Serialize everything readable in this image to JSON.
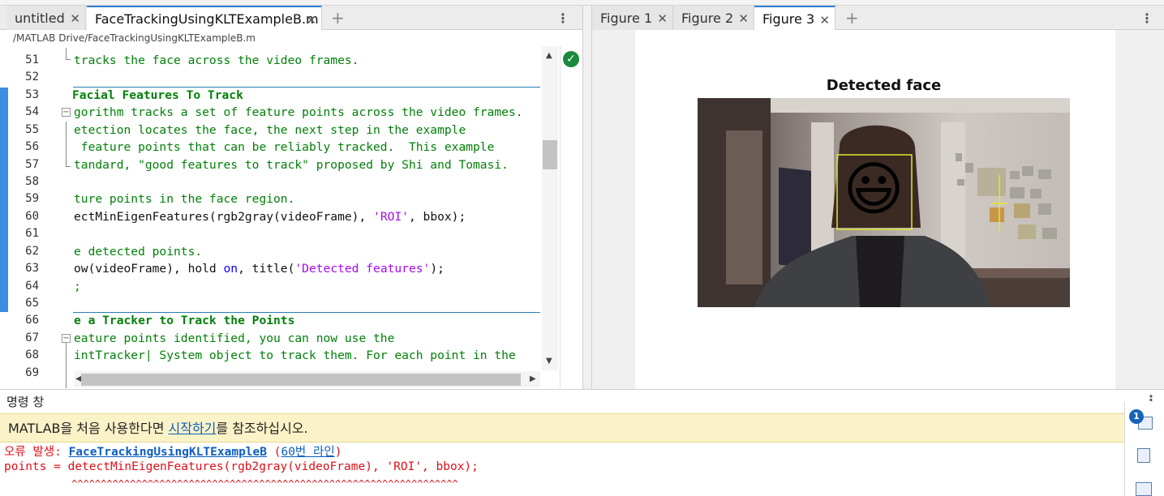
{
  "editor": {
    "tabs": [
      {
        "label": "untitled",
        "active": false
      },
      {
        "label": "FaceTrackingUsingKLTExampleB.m",
        "active": true
      }
    ],
    "path": "/MATLAB Drive/FaceTrackingUsingKLTExampleB.m",
    "lines": [
      {
        "num": "51",
        "text": "tracks the face across the video frames."
      },
      {
        "num": "52",
        "text": ""
      },
      {
        "num": "53",
        "text": "Facial Features To Track"
      },
      {
        "num": "54",
        "text": "gorithm tracks a set of feature points across the video frames."
      },
      {
        "num": "55",
        "text": "etection locates the face, the next step in the example"
      },
      {
        "num": "56",
        "text": " feature points that can be reliably tracked.  This example"
      },
      {
        "num": "57",
        "text": "tandard, \"good features to track\" proposed by Shi and Tomasi."
      },
      {
        "num": "58",
        "text": ""
      },
      {
        "num": "59",
        "text": "ture points in the face region."
      },
      {
        "num": "60",
        "pre": "ectMinEigenFeatures(rgb2gray(videoFrame), ",
        "str": "'ROI'",
        "post": ", bbox);"
      },
      {
        "num": "61",
        "text": ""
      },
      {
        "num": "62",
        "text": "e detected points."
      },
      {
        "num": "63",
        "pre": "ow(videoFrame), hold ",
        "kw": "on",
        "mid": ", title(",
        "str": "'Detected features'",
        "post": ");"
      },
      {
        "num": "64",
        "text": ";"
      },
      {
        "num": "65",
        "text": ""
      },
      {
        "num": "66",
        "text": "e a Tracker to Track the Points"
      },
      {
        "num": "67",
        "text": "eature points identified, you can now use the"
      },
      {
        "num": "68",
        "text": "intTracker| System object to track them. For each point in the"
      },
      {
        "num": "69",
        "text": ""
      }
    ]
  },
  "figures": {
    "tabs": [
      {
        "label": "Figure 1",
        "active": false
      },
      {
        "label": "Figure 2",
        "active": false
      },
      {
        "label": "Figure 3",
        "active": true
      }
    ],
    "title": "Detected face",
    "emoji": "😃"
  },
  "command": {
    "header": "명령 창",
    "banner_pre": "MATLAB을 처음 사용한다면 ",
    "banner_link": "시작하기",
    "banner_post": "를 참조하십시오.",
    "err_prefix": "오류 발생: ",
    "err_file": "FaceTrackingUsingKLTExampleB",
    "err_open": " (",
    "err_line": "60번 라인",
    "err_close": ")",
    "err_code": "points = detectMinEigenFeatures(rgb2gray(videoFrame), 'ROI', bbox);",
    "err_caret": "^^^^^^^^^^^^^^^^^^^^^^^^^^^^^^^^^^^^^^^^^^^^^^^^^^^^^^^^^^^^^^^^^^",
    "notification_count": "1"
  },
  "colors": {
    "accent": "#2f7fd6",
    "comment_green": "#028009",
    "string_purple": "#a709f5",
    "error_red": "#e0101a",
    "banner_yellow": "#fbf3c8"
  }
}
